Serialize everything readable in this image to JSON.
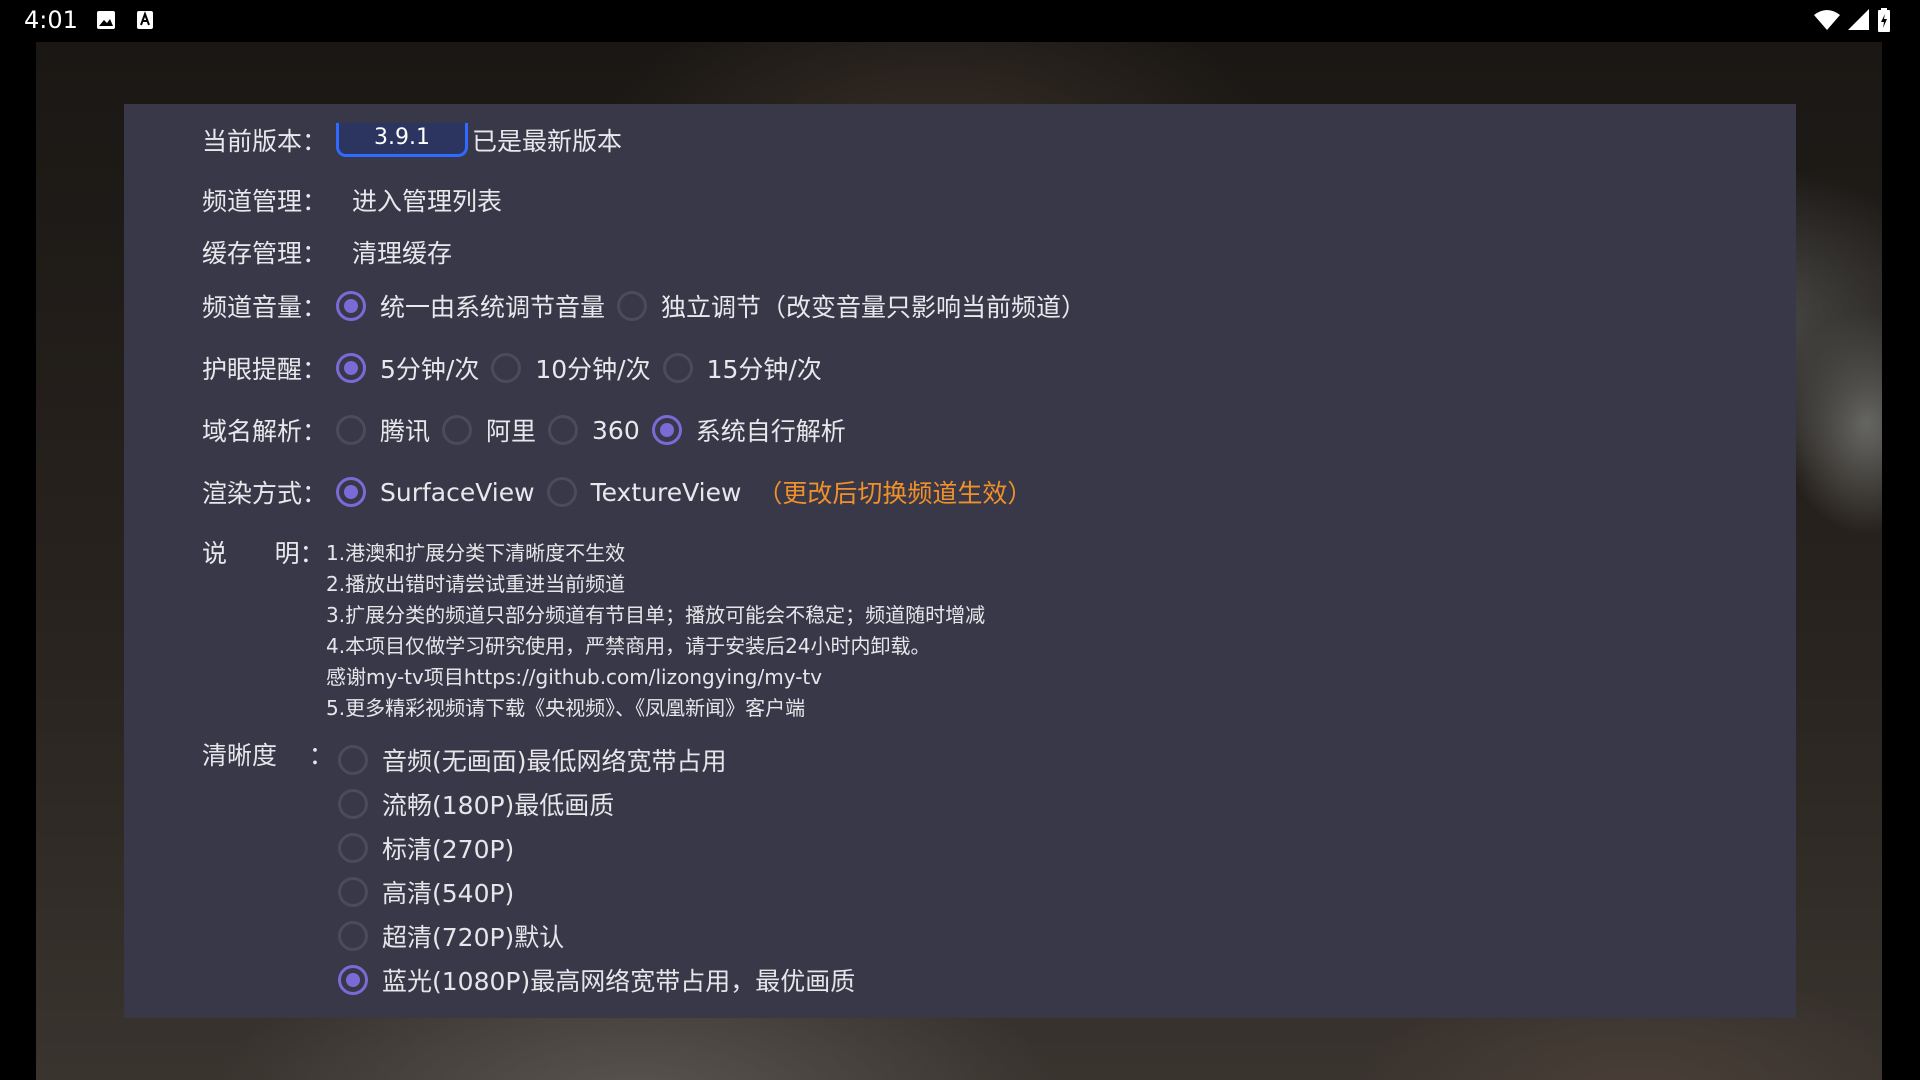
{
  "status_bar": {
    "time": "4:01",
    "left_icons": [
      "image-icon",
      "text-a-icon"
    ],
    "right_icons": [
      "wifi-icon",
      "signal-icon",
      "battery-icon"
    ]
  },
  "settings": {
    "version": {
      "label": "当前版本：",
      "value": "3.9.1",
      "status": "已是最新版本"
    },
    "channel_manage": {
      "label": "频道管理：",
      "action": "进入管理列表"
    },
    "cache_manage": {
      "label": "缓存管理：",
      "action": "清理缓存"
    },
    "channel_volume": {
      "label": "频道音量：",
      "options": [
        "统一由系统调节音量",
        "独立调节（改变音量只影响当前频道）"
      ],
      "selected": 0
    },
    "eye_reminder": {
      "label": "护眼提醒：",
      "options": [
        "5分钟/次",
        "10分钟/次",
        "15分钟/次"
      ],
      "selected": 0
    },
    "dns": {
      "label": "域名解析：",
      "options": [
        "腾讯",
        "阿里",
        "360",
        "系统自行解析"
      ],
      "selected": 3
    },
    "render": {
      "label": "渲染方式：",
      "options": [
        "SurfaceView",
        "TextureView"
      ],
      "selected": 0,
      "note": "（更改后切换频道生效）",
      "note_color": "#f0902a"
    },
    "notes": {
      "label": "说      明：",
      "lines": [
        "1.港澳和扩展分类下清晰度不生效",
        "2.播放出错时请尝试重进当前频道",
        "3.扩展分类的频道只部分频道有节目单；播放可能会不稳定；频道随时增减",
        "4.本项目仅做学习研究使用，严禁商用，请于安装后24小时内卸载。",
        "感谢my-tv项目https://github.com/lizongying/my-tv",
        "5.更多精彩视频请下载《央视频》、《凤凰新闻》客户端"
      ]
    },
    "quality": {
      "label": "清晰度    ：",
      "options": [
        "音频(无画面)最低网络宽带占用",
        "流畅(180P)最低画质",
        "标清(270P)",
        "高清(540P)",
        "超清(720P)默认",
        "蓝光(1080P)最高网络宽带占用，最优画质"
      ],
      "selected": 5
    }
  },
  "colors": {
    "dialog_bg": "#393848",
    "accent": "#7b6ad6",
    "version_border": "#2f6bff"
  }
}
